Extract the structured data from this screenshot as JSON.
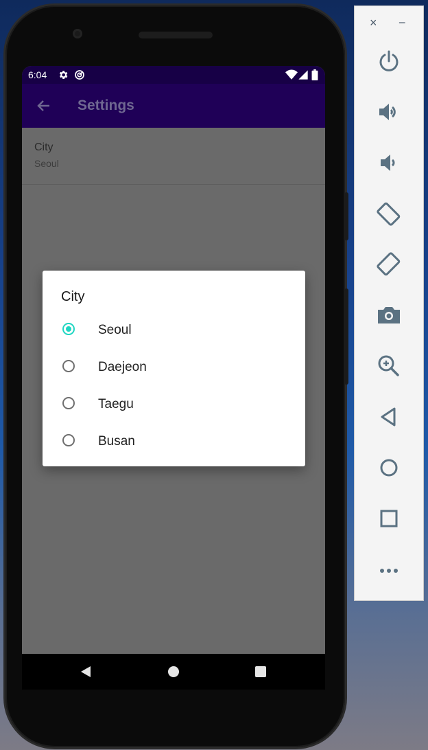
{
  "status_bar": {
    "time": "6:04"
  },
  "app_bar": {
    "title": "Settings"
  },
  "preference": {
    "label": "City",
    "value": "Seoul"
  },
  "dialog": {
    "title": "City",
    "options": [
      {
        "label": "Seoul",
        "selected": true
      },
      {
        "label": "Daejeon",
        "selected": false
      },
      {
        "label": "Taegu",
        "selected": false
      },
      {
        "label": "Busan",
        "selected": false
      }
    ]
  },
  "emulator": {
    "close": "×",
    "minimize": "−",
    "tools": [
      "power-icon",
      "volume-up-icon",
      "volume-down-icon",
      "rotate-left-icon",
      "rotate-right-icon",
      "camera-icon",
      "zoom-icon",
      "back-icon",
      "home-icon",
      "overview-icon",
      "more-icon"
    ]
  },
  "colors": {
    "accent": "#1ed6c2",
    "app_bar": "#1f0057",
    "status_bar": "#170046",
    "scrim": "#6a6a6a"
  }
}
